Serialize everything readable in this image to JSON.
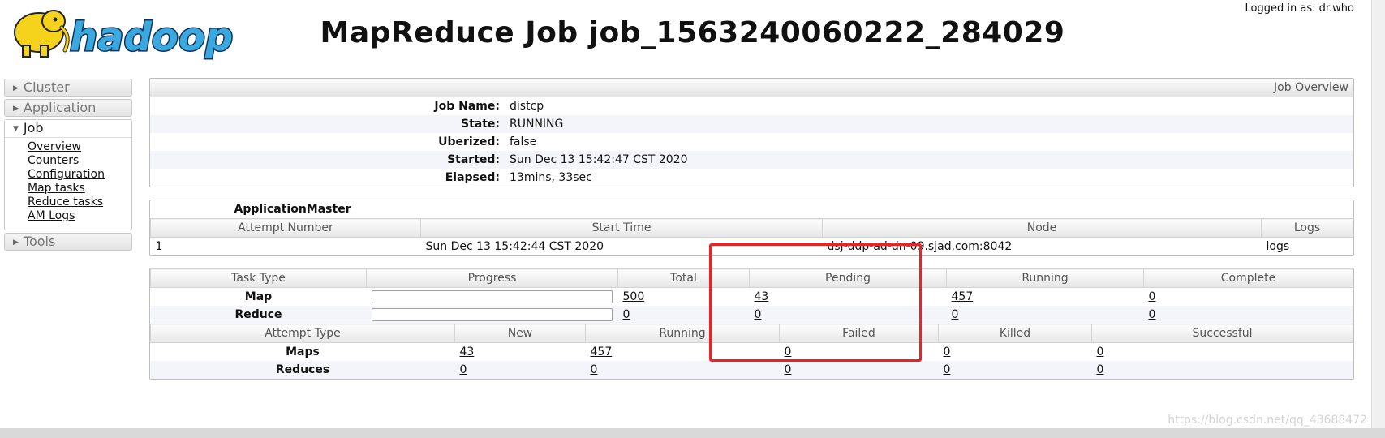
{
  "header": {
    "logo_text": "hadoop",
    "title": "MapReduce Job job_1563240060222_284029",
    "logged_in": "Logged in as: dr.who"
  },
  "nav": {
    "cluster": "Cluster",
    "application": "Application",
    "job": "Job",
    "job_items": [
      "Overview",
      "Counters",
      "Configuration",
      "Map tasks",
      "Reduce tasks",
      "AM Logs"
    ],
    "tools": "Tools"
  },
  "overview": {
    "header": "Job Overview",
    "rows": [
      {
        "label": "Job Name:",
        "value": "distcp"
      },
      {
        "label": "State:",
        "value": "RUNNING"
      },
      {
        "label": "Uberized:",
        "value": "false"
      },
      {
        "label": "Started:",
        "value": "Sun Dec 13 15:42:47 CST 2020"
      },
      {
        "label": "Elapsed:",
        "value": "13mins, 33sec"
      }
    ]
  },
  "am": {
    "title": "ApplicationMaster",
    "columns": [
      "Attempt Number",
      "Start Time",
      "Node",
      "Logs"
    ],
    "row": {
      "attempt": "1",
      "start": "Sun Dec 13 15:42:44 CST 2020",
      "node": "dsj-ddp-ad-dn-09.sjad.com:8042",
      "logs": "logs"
    }
  },
  "tasks": {
    "columns": [
      "Task Type",
      "Progress",
      "Total",
      "Pending",
      "Running",
      "Complete"
    ],
    "rows": [
      {
        "type": "Map",
        "progress": 0,
        "total": "500",
        "pending": "43",
        "running": "457",
        "complete": "0"
      },
      {
        "type": "Reduce",
        "progress": 0,
        "total": "0",
        "pending": "0",
        "running": "0",
        "complete": "0"
      }
    ]
  },
  "attempts": {
    "columns": [
      "Attempt Type",
      "New",
      "Running",
      "Failed",
      "Killed",
      "Successful"
    ],
    "rows": [
      {
        "type": "Maps",
        "new": "43",
        "running": "457",
        "failed": "0",
        "killed": "0",
        "successful": "0"
      },
      {
        "type": "Reduces",
        "new": "0",
        "running": "0",
        "failed": "0",
        "killed": "0",
        "successful": "0"
      }
    ]
  },
  "watermark": "https://blog.csdn.net/qq_43688472",
  "colors": {
    "annotation": "#ee2222",
    "logo_fill": "#3aa9e0",
    "elephant": "#f5d21c"
  }
}
